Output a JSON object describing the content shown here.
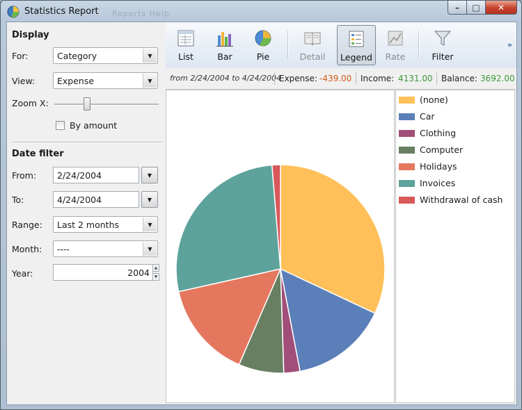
{
  "window": {
    "title": "Statistics Report",
    "ghost_title": "Reports  Help",
    "controls": {
      "minimize": "–",
      "maximize": "□",
      "close": "✕"
    }
  },
  "display": {
    "heading": "Display",
    "for_label": "For:",
    "for_value": "Category",
    "view_label": "View:",
    "view_value": "Expense",
    "zoom_label": "Zoom X:",
    "zoom_level": 0.3,
    "by_amount_label": "By amount",
    "by_amount_checked": false
  },
  "date_filter": {
    "heading": "Date filter",
    "from_label": "From:",
    "from_value": "2/24/2004",
    "to_label": "To:",
    "to_value": "4/24/2004",
    "range_label": "Range:",
    "range_value": "Last 2 months",
    "month_label": "Month:",
    "month_value": "----",
    "year_label": "Year:",
    "year_value": "2004"
  },
  "toolbar": {
    "list": "List",
    "bar": "Bar",
    "pie": "Pie",
    "detail": "Detail",
    "legend": "Legend",
    "rate": "Rate",
    "filter": "Filter",
    "more": "»"
  },
  "summary": {
    "range_text": "from 2/24/2004 to 4/24/2004",
    "expense_label": "Expense:",
    "expense_value": "-439.00",
    "income_label": "Income:",
    "income_value": "4131.00",
    "balance_label": "Balance:",
    "balance_value": "3692.00",
    "negative_color": "#d25a1a",
    "positive_color": "#3b9a3b"
  },
  "legend": [
    {
      "name": "(none)",
      "color": "#ffc05a"
    },
    {
      "name": "Car",
      "color": "#5b7fb8"
    },
    {
      "name": "Clothing",
      "color": "#a14e78"
    },
    {
      "name": "Computer",
      "color": "#687f62"
    },
    {
      "name": "Holidays",
      "color": "#e5775f"
    },
    {
      "name": "Invoices",
      "color": "#5da39b"
    },
    {
      "name": "Withdrawal of cash",
      "color": "#d9585a"
    }
  ],
  "chart_data": {
    "type": "pie",
    "slices": [
      {
        "label": "(none)",
        "percent": 32.0,
        "color": "#ffc05a"
      },
      {
        "label": "Car",
        "percent": 15.0,
        "color": "#5b7fb8"
      },
      {
        "label": "Clothing",
        "percent": 2.5,
        "color": "#a14e78"
      },
      {
        "label": "Computer",
        "percent": 7.0,
        "color": "#687f62"
      },
      {
        "label": "Holidays",
        "percent": 15.0,
        "color": "#e5775f"
      },
      {
        "label": "Invoices",
        "percent": 27.2,
        "color": "#5da39b"
      },
      {
        "label": "Withdrawal of cash",
        "percent": 1.3,
        "color": "#d9585a"
      }
    ],
    "start_angle": "12 o'clock",
    "direction": "clockwise"
  }
}
